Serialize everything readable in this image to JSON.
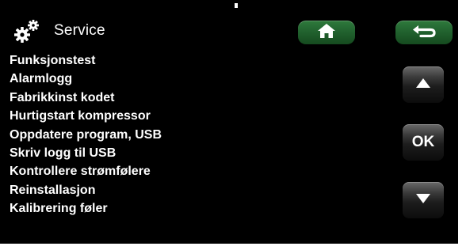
{
  "header": {
    "title": "Service",
    "icons": {
      "title_icon": "gears-icon",
      "home": "home-icon",
      "back": "back-arrow-icon"
    }
  },
  "menu": {
    "items": [
      "Funksjonstest",
      "Alarmlogg",
      "Fabrikkinst kodet",
      "Hurtigstart kompressor",
      "Oppdatere program, USB",
      "Skriv logg til USB",
      "Kontrollere strømfølere",
      "Reinstallasjon",
      "Kalibrering føler"
    ]
  },
  "nav": {
    "up_icon": "arrow-up-icon",
    "ok_label": "OK",
    "down_icon": "arrow-down-icon"
  },
  "colors": {
    "background": "#000000",
    "text": "#ffffff",
    "button_green": "#22632f",
    "button_dark": "#1d1d1d"
  }
}
